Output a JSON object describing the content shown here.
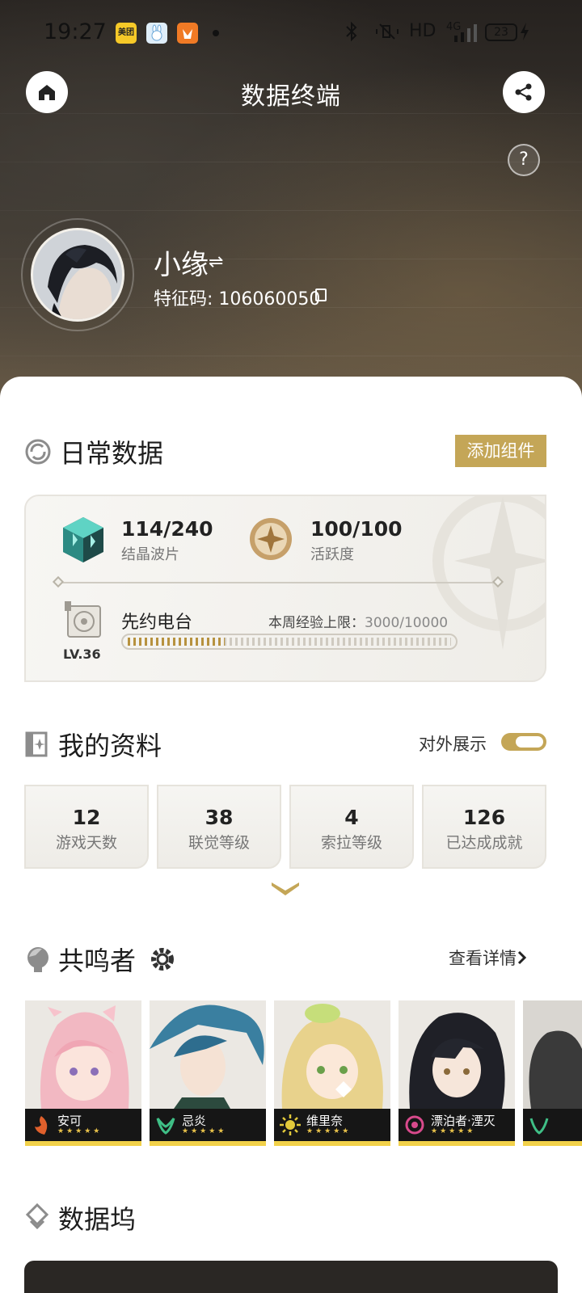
{
  "status_bar": {
    "time": "19:27",
    "app_badges": [
      "美团",
      "",
      ""
    ],
    "network": "HD",
    "signal": "4G",
    "battery": "23"
  },
  "header": {
    "title": "数据终端",
    "help": "?"
  },
  "user": {
    "name": "小缘",
    "swap_glyph": "⇌",
    "uid_label": "特征码:",
    "uid": "106060050"
  },
  "daily": {
    "title": "日常数据",
    "add_button": "添加组件",
    "waveplates": {
      "value": "114/240",
      "label": "结晶波片"
    },
    "activity": {
      "value": "100/100",
      "label": "活跃度"
    },
    "radio": {
      "name": "先约电台",
      "level": "LV.36",
      "weekly_label": "本周经验上限：",
      "weekly_value": "3000/10000",
      "progress": 0.3
    }
  },
  "profile": {
    "title": "我的资料",
    "public_label": "对外展示",
    "public_enabled": true,
    "stats": [
      {
        "value": "12",
        "label": "游戏天数"
      },
      {
        "value": "38",
        "label": "联觉等级"
      },
      {
        "value": "4",
        "label": "索拉等级"
      },
      {
        "value": "126",
        "label": "已达成成就"
      }
    ]
  },
  "resonators": {
    "title": "共鸣者",
    "view_details": "查看详情",
    "items": [
      {
        "name": "安可",
        "stars": "★★★★★",
        "element": "fusion",
        "color": "#e0602c"
      },
      {
        "name": "忌炎",
        "stars": "★★★★★",
        "element": "aero",
        "color": "#3fbf86"
      },
      {
        "name": "维里奈",
        "stars": "★★★★★",
        "element": "spectro",
        "color": "#e2c93b"
      },
      {
        "name": "漂泊者·湮灭",
        "stars": "★★★★★",
        "element": "havoc",
        "color": "#d94a8c"
      }
    ]
  },
  "databank": {
    "title": "数据坞"
  }
}
